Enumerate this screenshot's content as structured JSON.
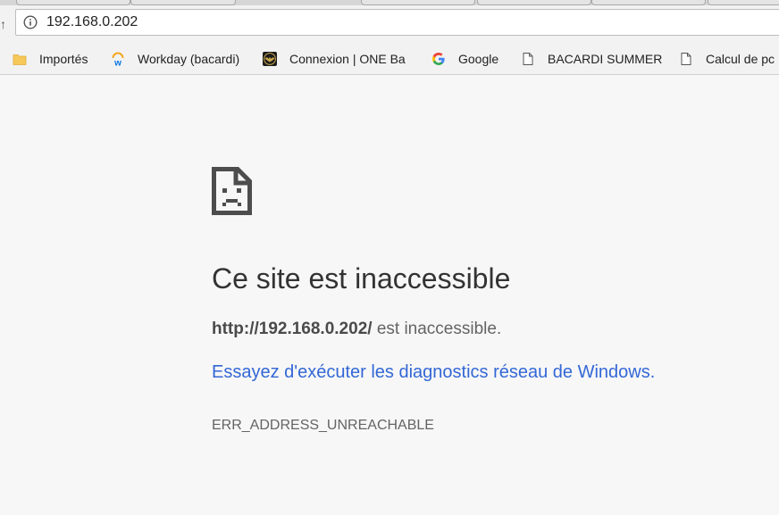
{
  "address_bar": {
    "url": "192.168.0.202"
  },
  "bookmarks": [
    {
      "label": "Importés",
      "icon": "folder-icon"
    },
    {
      "label": "Workday (bacardi)",
      "icon": "workday-icon"
    },
    {
      "label": "Connexion | ONE Ba",
      "icon": "bacardi-bat-icon"
    },
    {
      "label": "Google",
      "icon": "google-icon"
    },
    {
      "label": "BACARDI SUMMER",
      "icon": "page-icon"
    },
    {
      "label": "Calcul de pc",
      "icon": "page-icon"
    }
  ],
  "error": {
    "icon": "sad-page-icon",
    "title": "Ce site est inaccessible",
    "host": "http://192.168.0.202/",
    "host_suffix": " est inaccessible.",
    "suggestion_link": "Essayez d'exécuter les diagnostics réseau de Windows.",
    "code": "ERR_ADDRESS_UNREACHABLE"
  },
  "colors": {
    "link": "#3367d6",
    "title": "#333333",
    "body_text": "#646464",
    "page_bg": "#f7f7f7"
  }
}
